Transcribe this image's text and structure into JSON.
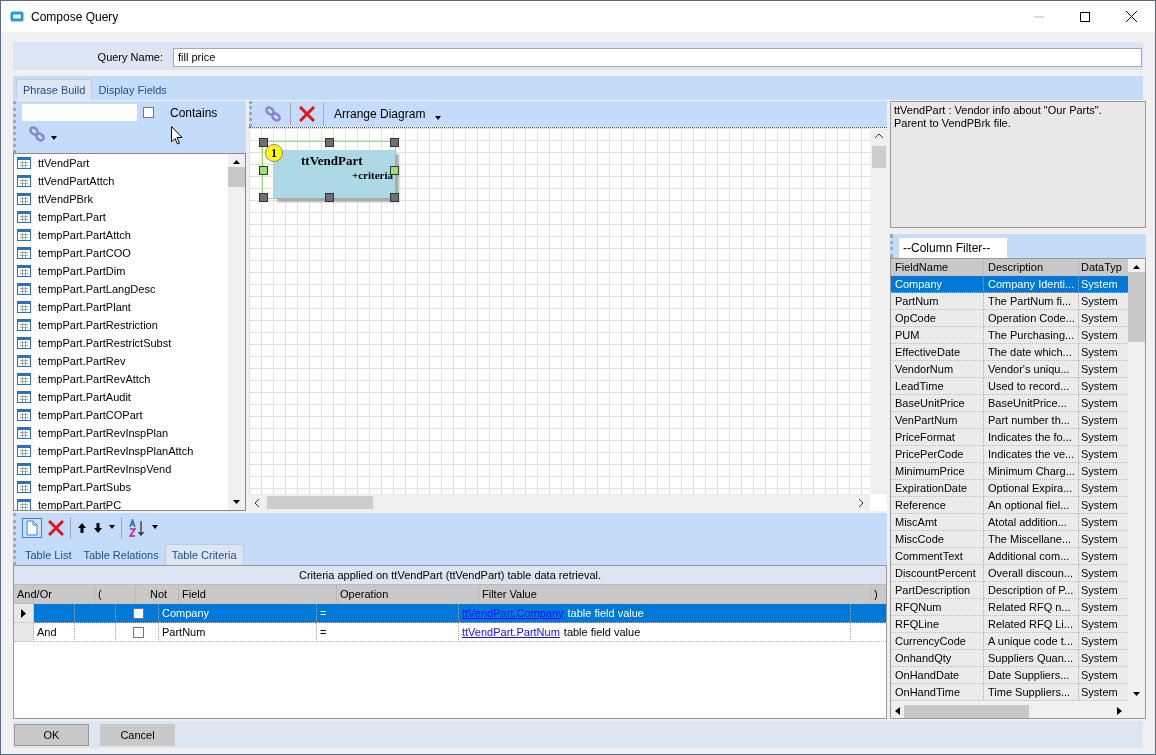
{
  "window": {
    "title": "Compose Query"
  },
  "query_name": {
    "label": "Query Name:",
    "value": "fill price"
  },
  "tabs": [
    {
      "label": "Phrase Build",
      "selected": true
    },
    {
      "label": "Display Fields",
      "selected": false
    }
  ],
  "table_search": {
    "contains_label": "Contains",
    "contains_checked": false
  },
  "table_list": [
    "ttVendPart",
    "ttVendPartAttch",
    "ttVendPBrk",
    "tempPart.Part",
    "tempPart.PartAttch",
    "tempPart.PartCOO",
    "tempPart.PartDim",
    "tempPart.PartLangDesc",
    "tempPart.PartPlant",
    "tempPart.PartRestriction",
    "tempPart.PartRestrictSubst",
    "tempPart.PartRev",
    "tempPart.PartRevAttch",
    "tempPart.PartAudit",
    "tempPart.PartCOPart",
    "tempPart.PartRevInspPlan",
    "tempPart.PartRevInspPlanAttch",
    "tempPart.PartRevInspVend",
    "tempPart.PartSubs",
    "tempPart.PartPC"
  ],
  "diagram_toolbar": {
    "arrange_label": "Arrange Diagram"
  },
  "diagram": {
    "nodes": [
      {
        "number": "1",
        "name": "ttVendPart",
        "note": "+criteria",
        "selected": true
      }
    ]
  },
  "description": "ttVendPart : Vendor info about \"Our Parts\".\nParent to VendPBrk file.",
  "column_filter": {
    "value": "--Column Filter--"
  },
  "fields_grid": {
    "columns": [
      "FieldName",
      "Description",
      "DataTyp"
    ],
    "rows": [
      {
        "field": "Company",
        "description": "Company Identi...",
        "type": "System",
        "selected": true
      },
      {
        "field": "PartNum",
        "description": "The PartNum fi...",
        "type": "System",
        "selected": false
      },
      {
        "field": "OpCode",
        "description": "Operation Code...",
        "type": "System",
        "selected": false
      },
      {
        "field": "PUM",
        "description": "The Purchasing...",
        "type": "System",
        "selected": false
      },
      {
        "field": "EffectiveDate",
        "description": "The date which...",
        "type": "System",
        "selected": false
      },
      {
        "field": "VendorNum",
        "description": "Vendor's uniqu...",
        "type": "System",
        "selected": false
      },
      {
        "field": "LeadTime",
        "description": "Used to record...",
        "type": "System",
        "selected": false
      },
      {
        "field": "BaseUnitPrice",
        "description": "BaseUnitPrice...",
        "type": "System",
        "selected": false
      },
      {
        "field": "VenPartNum",
        "description": "Part number th...",
        "type": "System",
        "selected": false
      },
      {
        "field": "PriceFormat",
        "description": "Indicates the fo...",
        "type": "System",
        "selected": false
      },
      {
        "field": "PricePerCode",
        "description": "Indicates the ve...",
        "type": "System",
        "selected": false
      },
      {
        "field": "MinimumPrice",
        "description": "Minimum Charg...",
        "type": "System",
        "selected": false
      },
      {
        "field": "ExpirationDate",
        "description": "Optional Expira...",
        "type": "System",
        "selected": false
      },
      {
        "field": "Reference",
        "description": "An optional fiel...",
        "type": "System",
        "selected": false
      },
      {
        "field": "MiscAmt",
        "description": "Atotal addition...",
        "type": "System",
        "selected": false
      },
      {
        "field": "MiscCode",
        "description": "The Miscellane...",
        "type": "System",
        "selected": false
      },
      {
        "field": "CommentText",
        "description": "Additional com...",
        "type": "System",
        "selected": false
      },
      {
        "field": "DiscountPercent",
        "description": "Overall discoun...",
        "type": "System",
        "selected": false
      },
      {
        "field": "PartDescription",
        "description": "Description of P...",
        "type": "System",
        "selected": false
      },
      {
        "field": "RFQNum",
        "description": "Related RFQ n...",
        "type": "System",
        "selected": false
      },
      {
        "field": "RFQLine",
        "description": "Related RFQ Li...",
        "type": "System",
        "selected": false
      },
      {
        "field": "CurrencyCode",
        "description": "A unique code t...",
        "type": "System",
        "selected": false
      },
      {
        "field": "OnhandQty",
        "description": "Suppliers Quan...",
        "type": "System",
        "selected": false
      },
      {
        "field": "OnHandDate",
        "description": "Date Suppliers...",
        "type": "System",
        "selected": false
      },
      {
        "field": "OnHandTime",
        "description": "Time Suppliers...",
        "type": "System",
        "selected": false
      }
    ]
  },
  "bottom_tabs": [
    {
      "label": "Table List",
      "selected": false
    },
    {
      "label": "Table Relations",
      "selected": false
    },
    {
      "label": "Table Criteria",
      "selected": true
    }
  ],
  "criteria": {
    "caption": "Criteria applied on ttVendPart (ttVendPart)  table data retrieval.",
    "columns": [
      "And/Or",
      "(",
      "Not",
      "Field",
      "Operation",
      "Filter Value",
      ")"
    ],
    "rows": [
      {
        "and_or": "",
        "not": false,
        "field": "Company",
        "operation": "=",
        "filter_link": "ttVendPart.Company",
        "filter_text": "table field value",
        "selected": true
      },
      {
        "and_or": "And",
        "not": false,
        "field": "PartNum",
        "operation": "=",
        "filter_link": "ttVendPart.PartNum",
        "filter_text": "table field value",
        "selected": false
      }
    ]
  },
  "buttons": [
    "OK",
    "Cancel"
  ]
}
